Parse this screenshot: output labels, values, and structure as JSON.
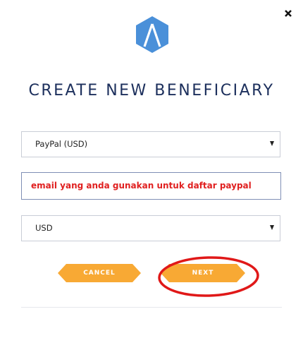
{
  "dialog": {
    "title": "CREATE NEW BENEFICIARY",
    "close_icon": "close-icon",
    "logo_icon": "hexagon-logo-icon"
  },
  "form": {
    "method_select": {
      "value": "PayPal (USD)"
    },
    "email_field": {
      "placeholder": "email yang anda gunakan untuk daftar paypal"
    },
    "currency_select": {
      "value": "USD"
    }
  },
  "actions": {
    "cancel_label": "CANCEL",
    "next_label": "NEXT"
  },
  "colors": {
    "accent": "#f8a934",
    "title": "#1c2f5c",
    "logo": "#4a90d9",
    "annotation": "#e01818",
    "hint_text": "#e02020"
  }
}
